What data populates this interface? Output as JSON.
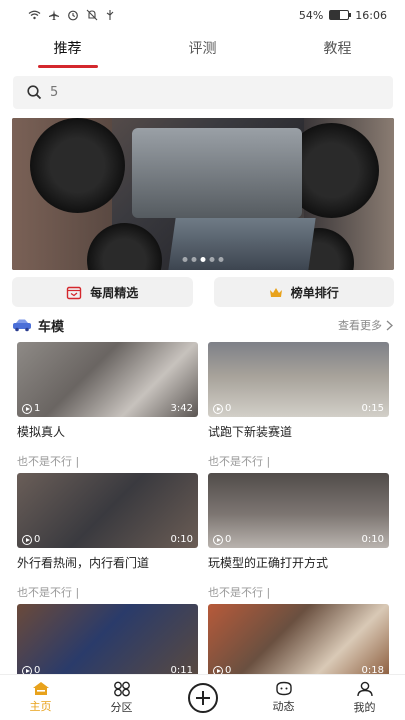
{
  "status": {
    "left_icons": [
      "wifi-icon",
      "airplane-icon",
      "alarm-icon",
      "mute-icon",
      "usb-icon"
    ],
    "battery_percent": "54%",
    "battery_level": 0.54,
    "time": "16:06"
  },
  "tabs": [
    {
      "label": "推荐",
      "active": true
    },
    {
      "label": "评测",
      "active": false
    },
    {
      "label": "教程",
      "active": false
    }
  ],
  "search": {
    "placeholder": "5"
  },
  "banner": {
    "page_count": 5,
    "current_page": 2
  },
  "quick": {
    "weekly": {
      "label": "每周精选",
      "icon": "calendar-icon"
    },
    "ranking": {
      "label": "榜单排行",
      "icon": "crown-icon"
    }
  },
  "section": {
    "title": "车模",
    "more_label": "查看更多",
    "icon": "car-icon"
  },
  "cards": [
    {
      "title": "模拟真人",
      "plays": "1",
      "duration": "3:42",
      "sub": "也不是不行 |"
    },
    {
      "title": "试跑下新装赛道",
      "plays": "0",
      "duration": "0:15",
      "sub": "也不是不行 |"
    },
    {
      "title": "外行看热闹，内行看门道",
      "plays": "0",
      "duration": "0:10",
      "sub": "也不是不行 |"
    },
    {
      "title": "玩模型的正确打开方式",
      "plays": "0",
      "duration": "0:10",
      "sub": "也不是不行 |"
    },
    {
      "title": "",
      "plays": "0",
      "duration": "0:11",
      "sub": ""
    },
    {
      "title": "",
      "plays": "0",
      "duration": "0:18",
      "sub": ""
    }
  ],
  "nav": [
    {
      "label": "主页",
      "icon": "home-icon",
      "active": true
    },
    {
      "label": "分区",
      "icon": "category-icon",
      "active": false
    },
    {
      "label": "",
      "icon": "add-icon",
      "active": false
    },
    {
      "label": "动态",
      "icon": "feed-icon",
      "active": false
    },
    {
      "label": "我的",
      "icon": "profile-icon",
      "active": false
    }
  ],
  "colors": {
    "accent": "#d4282d",
    "nav_active": "#e8a21c",
    "crown": "#e8a21c",
    "calendar": "#d4282d",
    "section_icon": "#4b6fd8"
  }
}
